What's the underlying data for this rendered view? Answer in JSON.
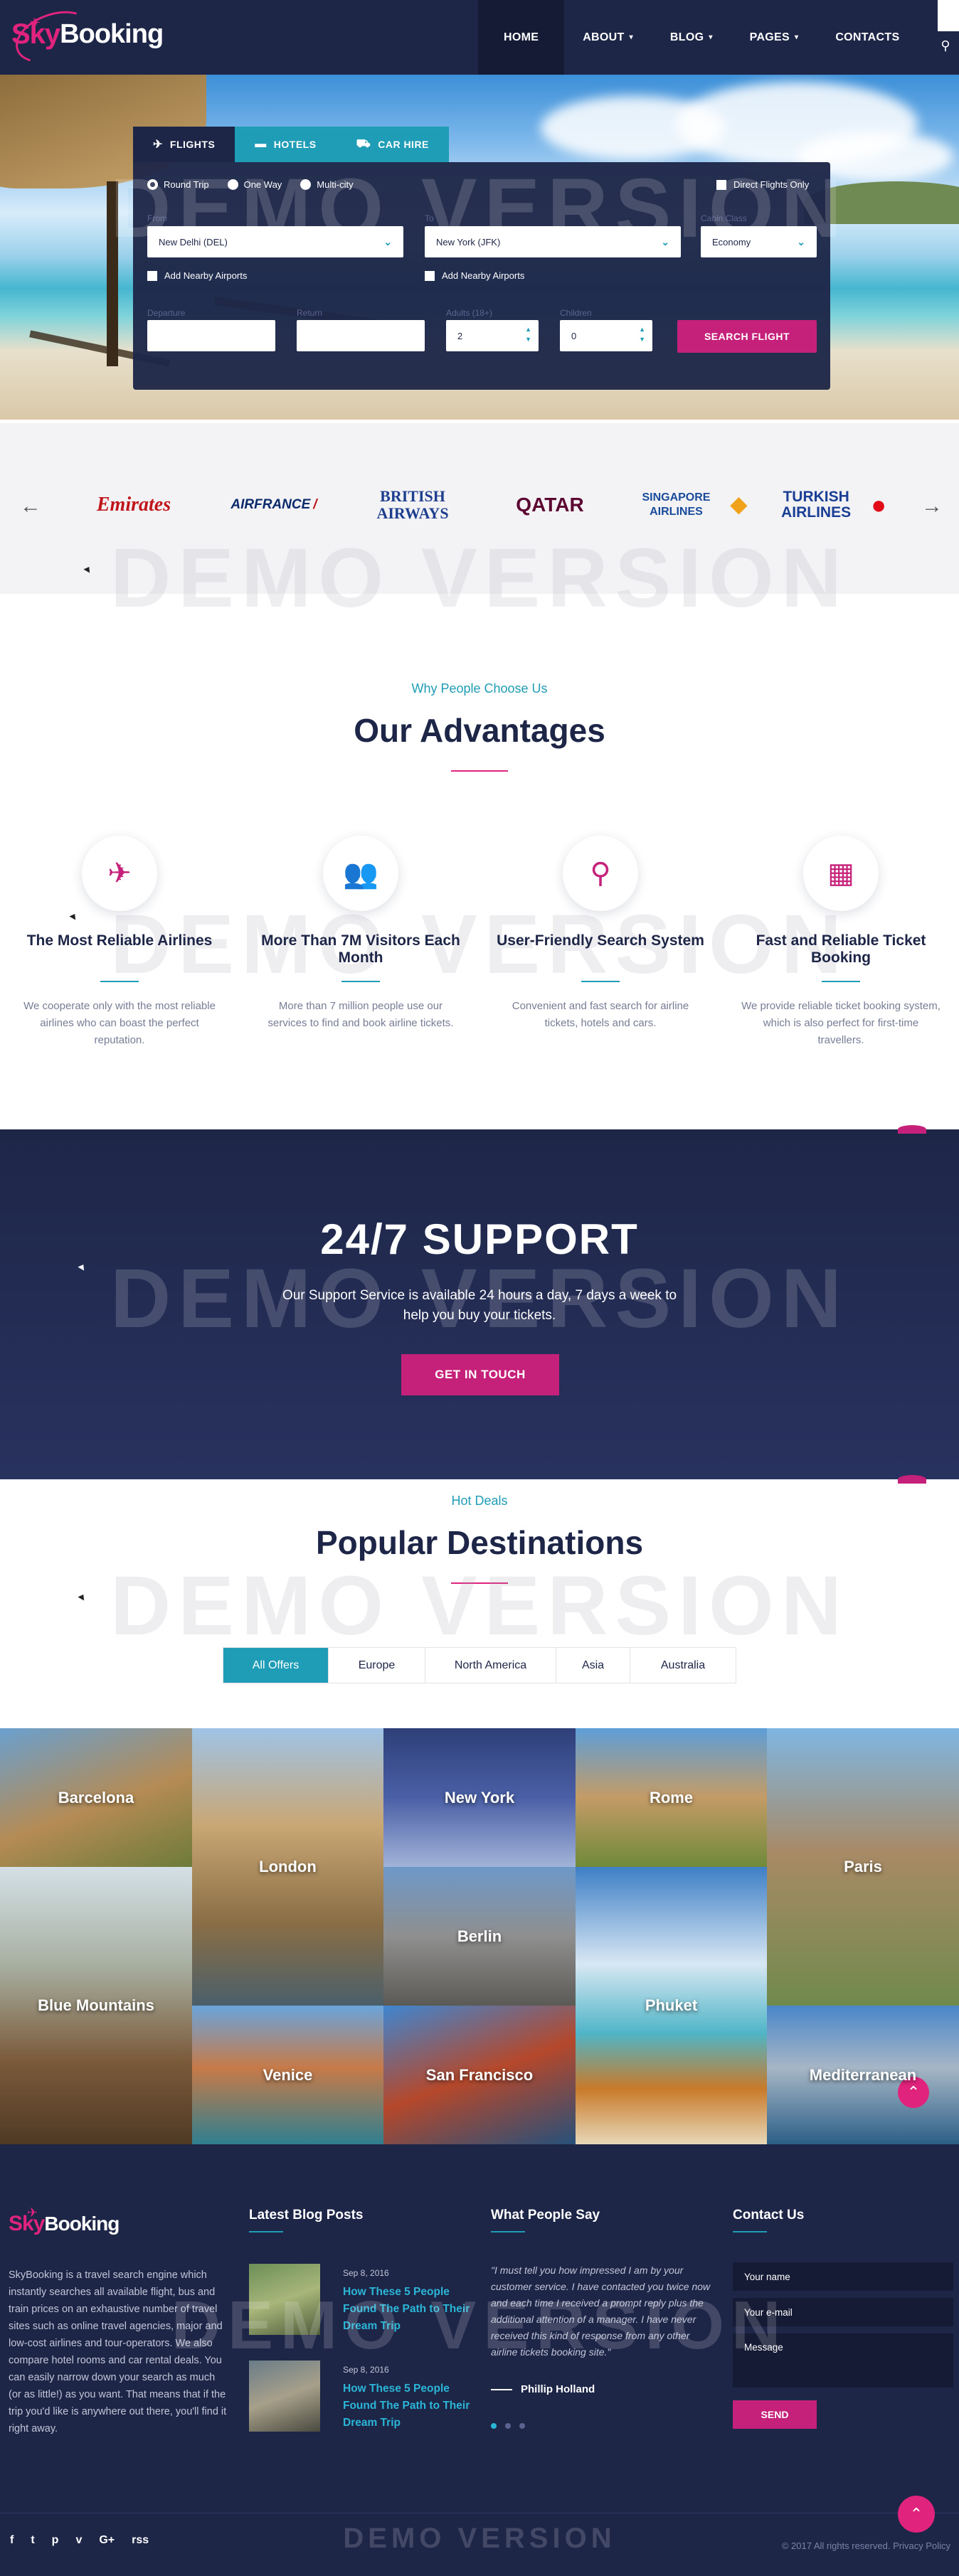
{
  "brand": {
    "part1": "Sky",
    "part2": "Booking",
    "accent": "#e0237c",
    "navy": "#1e2648",
    "teal": "#1f9db6"
  },
  "nav": {
    "items": [
      {
        "label": "HOME"
      },
      {
        "label": "ABOUT"
      },
      {
        "label": "BLOG"
      },
      {
        "label": "PAGES"
      },
      {
        "label": "CONTACTS"
      }
    ],
    "caret": "▾",
    "search_icon": "search-icon"
  },
  "search": {
    "tabs": [
      {
        "label": "FLIGHTS",
        "icon": "plane-icon"
      },
      {
        "label": "HOTELS",
        "icon": "bed-icon"
      },
      {
        "label": "CAR HIRE",
        "icon": "car-icon"
      }
    ],
    "trip_types": [
      "Round Trip",
      "One Way",
      "Multi-city"
    ],
    "selected_trip": "Round Trip",
    "direct_only": "Direct Flights Only",
    "from_label": "From",
    "from_value": "New Delhi (DEL)",
    "to_label": "To",
    "to_value": "New York (JFK)",
    "class_label": "Cabin Class",
    "class_value": "Economy",
    "nearby_from": "Add Nearby Airports",
    "nearby_to": "Add Nearby Airports",
    "departure_label": "Departure",
    "return_label": "Return",
    "adults_label": "Adults (18+)",
    "adults_value": "2",
    "children_label": "Children",
    "children_value": "0",
    "button": "SEARCH FLIGHT"
  },
  "airlines": [
    "Emirates",
    "AIRFRANCE",
    "BRITISH AIRWAYS",
    "QATAR",
    "SINGAPORE AIRLINES",
    "TURKISH AIRLINES"
  ],
  "advantages": {
    "subtitle": "Why People Choose Us",
    "title": "Our Advantages",
    "items": [
      {
        "title": "The Most Reliable Airlines",
        "text": "We cooperate only with the most reliable airlines who can boast the perfect reputation.",
        "icon": "plane-icon"
      },
      {
        "title": "More Than 7M Visitors Each Month",
        "text": "More than 7 million people use our services to find and book airline tickets.",
        "icon": "users-icon"
      },
      {
        "title": "User-Friendly Search System",
        "text": "Convenient and fast search for airline tickets, hotels and cars.",
        "icon": "search-icon"
      },
      {
        "title": "Fast and Reliable Ticket Booking",
        "text": "We provide reliable ticket booking system, which is also perfect for first-time travellers.",
        "icon": "calendar-check-icon"
      }
    ]
  },
  "support": {
    "title": "24/7 SUPPORT",
    "text": "Our Support Service is available 24 hours a day, 7 days a week to help you buy your tickets.",
    "button": "GET IN TOUCH"
  },
  "destinations": {
    "subtitle": "Hot Deals",
    "title": "Popular Destinations",
    "filters": [
      "All Offers",
      "Europe",
      "North America",
      "Asia",
      "Australia"
    ],
    "active_filter": "All Offers",
    "tiles": [
      "Barcelona",
      "London",
      "New York",
      "Rome",
      "Paris",
      "Blue Mountains",
      "Berlin",
      "Phuket",
      "Venice",
      "San Francisco",
      "Mediterranean"
    ]
  },
  "footer": {
    "about": "SkyBooking is a travel search engine which instantly searches all available flight, bus and train prices on an exhaustive number of travel sites such as online travel agencies, major and low-cost airlines and tour-operators. We also compare hotel rooms and car rental deals. You can easily narrow down your search as much (or as little!) as you want. That means that if the trip you'd like is anywhere out there, you'll find it right away.",
    "blog_heading": "Latest Blog Posts",
    "posts": [
      {
        "date": "Sep 8, 2016",
        "title": "How These 5 People Found The Path to Their Dream Trip"
      },
      {
        "date": "Sep 8, 2016",
        "title": "How These 5 People Found The Path to Their Dream Trip"
      }
    ],
    "testimonial_heading": "What People Say",
    "quote": "\"I must tell you how impressed I am by your customer service. I have contacted you twice now and each time I received a prompt reply plus the additional attention of a manager. I have never received this kind of response from any other airline tickets booking site.\"",
    "quote_author": "Phillip Holland",
    "contact_heading": "Contact Us",
    "name_placeholder": "Your name",
    "email_placeholder": "Your e-mail",
    "message_placeholder": "Message",
    "send": "SEND",
    "copyright": "© 2017 All rights reserved. Privacy Policy",
    "social": [
      "f",
      "t",
      "p",
      "v",
      "G+",
      "rss"
    ]
  },
  "watermark": "DEMO VERSION"
}
